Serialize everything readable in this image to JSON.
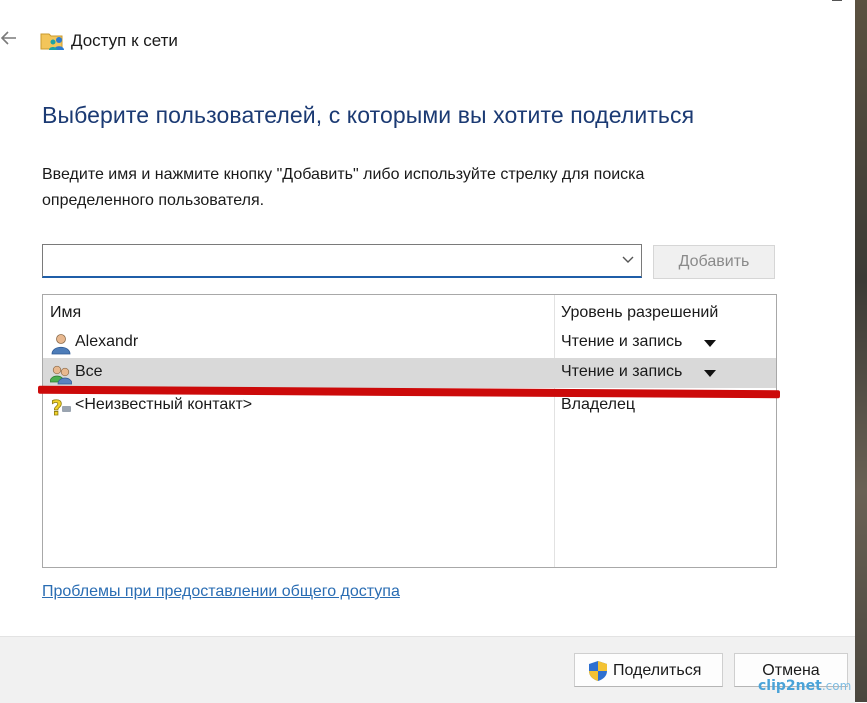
{
  "window": {
    "title": "Доступ к сети",
    "back_icon": "back-arrow-icon"
  },
  "main": {
    "heading": "Выберите пользователей, с которыми вы хотите поделиться",
    "instruction": "Введите имя и нажмите кнопку \"Добавить\" либо используйте стрелку для поиска определенного пользователя.",
    "combo": {
      "value": "",
      "icon": "chevron-down-icon"
    },
    "add_button": "Добавить"
  },
  "list": {
    "headers": {
      "name": "Имя",
      "permission": "Уровень разрешений"
    },
    "rows": [
      {
        "name": "Alexandr",
        "permission": "Чтение и запись",
        "icon": "user-icon",
        "has_dropdown": true,
        "selected": false
      },
      {
        "name": "Все",
        "permission": "Чтение и запись",
        "icon": "group-icon",
        "has_dropdown": true,
        "selected": true
      },
      {
        "name": "<Неизвестный контакт>",
        "permission": "Владелец",
        "icon": "unknown-contact-icon",
        "has_dropdown": false,
        "selected": false
      }
    ]
  },
  "help_link": "Проблемы при предоставлении общего доступа",
  "footer": {
    "share_button": "Поделиться",
    "share_icon": "uac-shield-icon",
    "cancel_button": "Отмена"
  },
  "watermark": {
    "brand": "clip2net",
    "suffix": ".com"
  },
  "colors": {
    "heading": "#1b3a73",
    "link": "#2a6db3",
    "selected_row": "#d9d9d9",
    "annotation_red": "#cc0a0a",
    "focus_border": "#1f5ea8"
  }
}
